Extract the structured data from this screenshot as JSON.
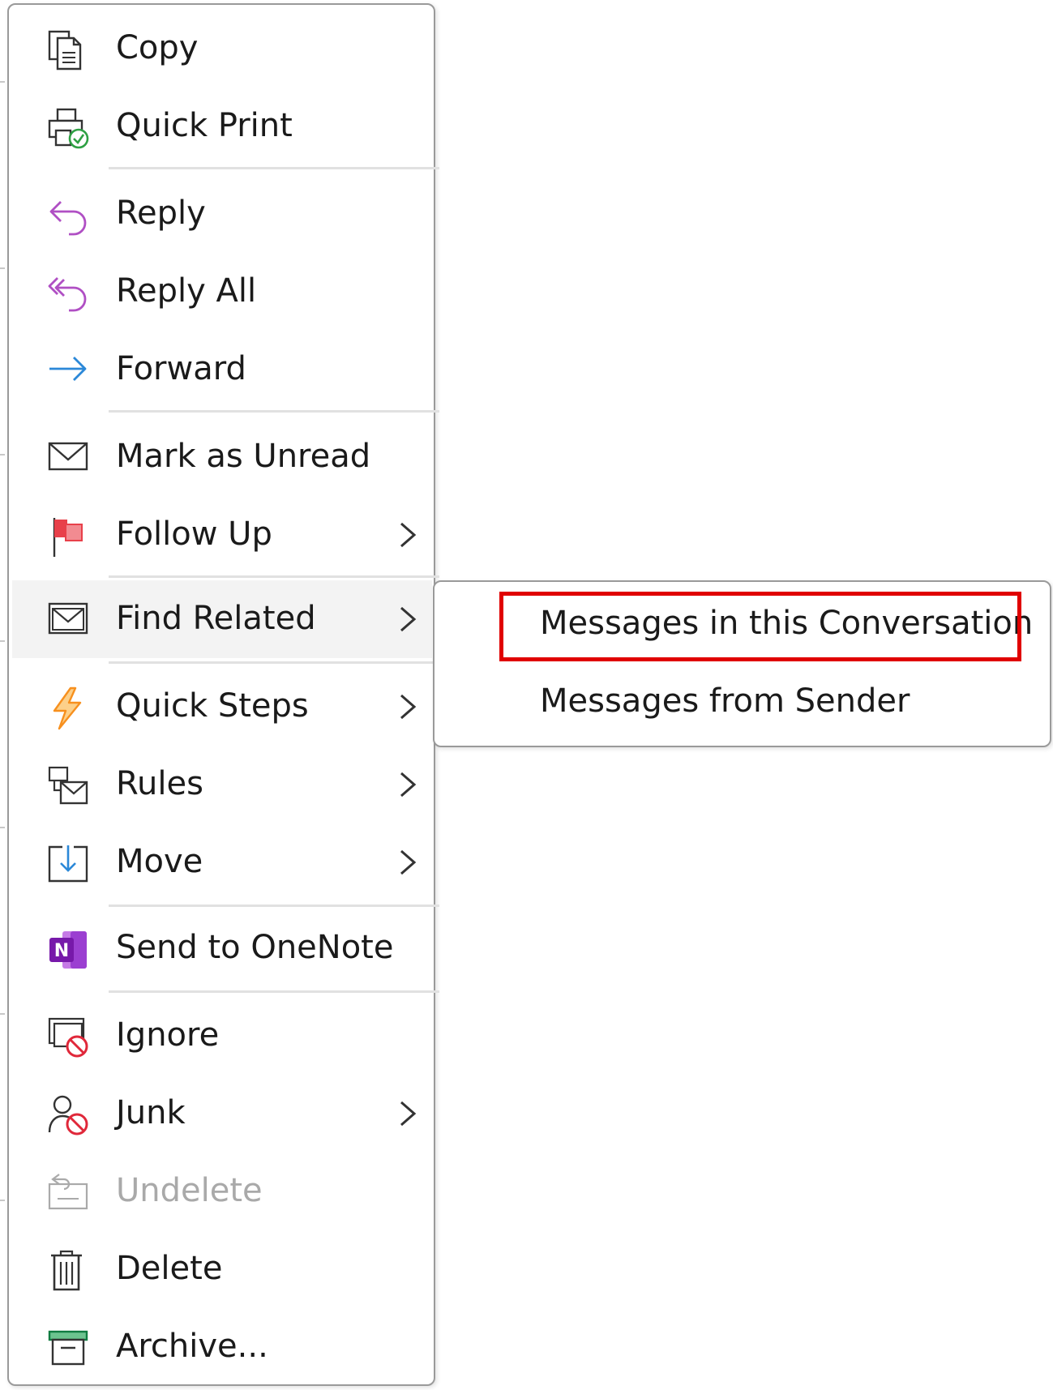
{
  "context_menu": {
    "items": [
      {
        "label": "Copy",
        "icon": "copy-icon"
      },
      {
        "label": "Quick Print",
        "icon": "quick-print-icon"
      },
      {
        "label": "Reply",
        "icon": "reply-icon"
      },
      {
        "label": "Reply All",
        "icon": "reply-all-icon"
      },
      {
        "label": "Forward",
        "icon": "forward-icon"
      },
      {
        "label": "Mark as Unread",
        "icon": "envelope-icon"
      },
      {
        "label": "Follow Up",
        "icon": "flag-icon",
        "submenu": true
      },
      {
        "label": "Find Related",
        "icon": "find-related-icon",
        "submenu": true,
        "state": "hover"
      },
      {
        "label": "Quick Steps",
        "icon": "lightning-icon",
        "submenu": true
      },
      {
        "label": "Rules",
        "icon": "rules-icon",
        "submenu": true
      },
      {
        "label": "Move",
        "icon": "move-icon",
        "submenu": true
      },
      {
        "label": "Send to OneNote",
        "icon": "onenote-icon"
      },
      {
        "label": "Ignore",
        "icon": "ignore-icon"
      },
      {
        "label": "Junk",
        "icon": "junk-icon",
        "submenu": true
      },
      {
        "label": "Undelete",
        "icon": "undelete-icon",
        "disabled": true
      },
      {
        "label": "Delete",
        "icon": "trash-icon"
      },
      {
        "label": "Archive...",
        "icon": "archive-icon"
      }
    ]
  },
  "find_related_submenu": {
    "items": [
      {
        "label": "Messages in this Conversation",
        "highlighted": true
      },
      {
        "label": "Messages from Sender"
      }
    ]
  },
  "colors": {
    "highlight_box": "#e00000",
    "reply_purple": "#b04fc4",
    "forward_blue": "#2b88d8",
    "flag_red": "#e8404a",
    "lightning_orange": "#f7901e",
    "onenote_purple": "#7719aa",
    "ignore_red": "#e0283a",
    "print_green": "#2ea043",
    "archive_green": "#107c41"
  }
}
